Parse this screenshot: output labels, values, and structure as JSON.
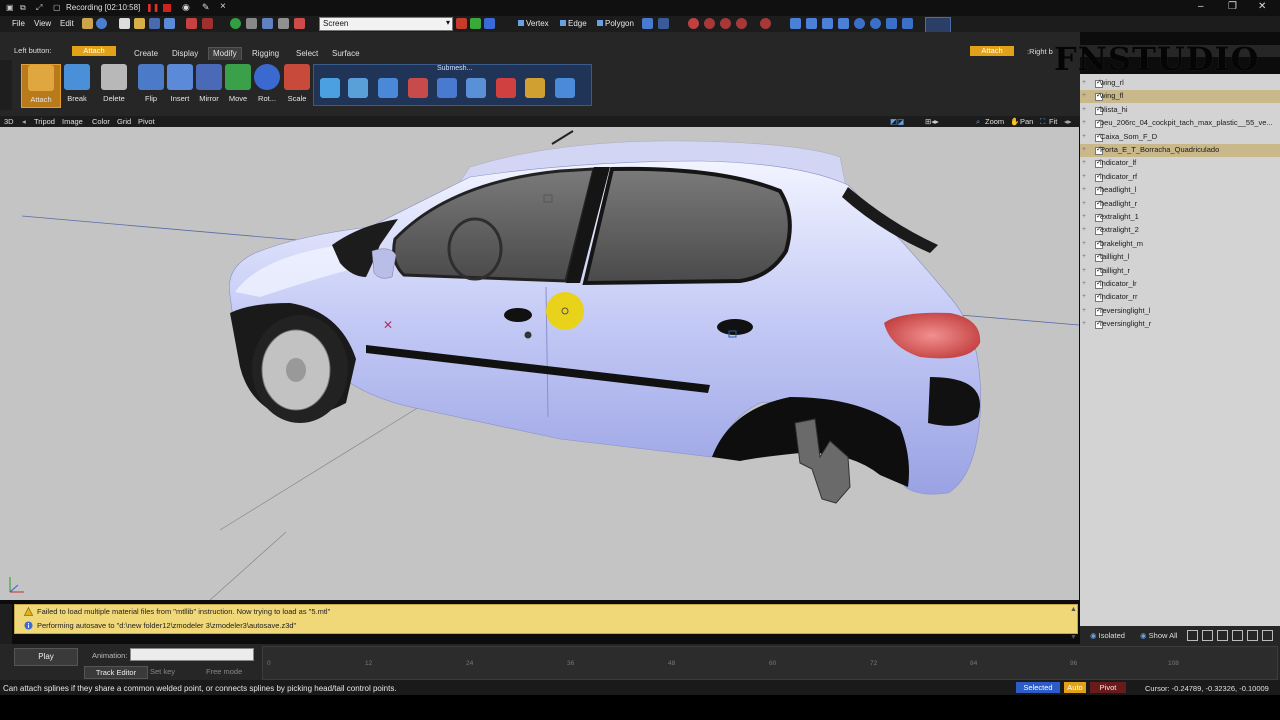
{
  "title_bar": {
    "recording": "Recording [02:10:58]"
  },
  "menu": {
    "file": "File",
    "view": "View",
    "edit": "Edit"
  },
  "toolbar": {
    "screen_select": "Screen",
    "vertex": "Vertex",
    "edge": "Edge",
    "polygon": "Polygon"
  },
  "ribbon": {
    "left_button_label": "Left button:",
    "attach_chip": "Attach",
    "tabs": [
      "Create",
      "Display",
      "Modify",
      "Rigging",
      "Select",
      "Surface"
    ],
    "tools": [
      "Attach",
      "Break",
      "Delete",
      "Flip",
      "Insert",
      "Mirror",
      "Move",
      "Rot...",
      "Scale"
    ],
    "submesh_label": "Submesh..."
  },
  "viewport_toolbar": {
    "mode": "3D",
    "items": [
      "Tripod",
      "Image",
      "Color",
      "Grid",
      "Pivot"
    ],
    "zoom": "Zoom",
    "pan": "Pan",
    "fit": "Fit"
  },
  "right_panel": {
    "attach_chip": "Attach",
    "right_button": ":Right b",
    "watermark": "FNSTUDIO",
    "tree_items": [
      {
        "label": "wing_rl",
        "checked": true,
        "selected": false
      },
      {
        "label": "wing_fl",
        "checked": true,
        "selected": true
      },
      {
        "label": "blista_hi",
        "checked": true,
        "selected": false
      },
      {
        "label": "peu_206rc_04_cockpit_tach_max_plastic__55_ve...",
        "checked": true,
        "selected": false
      },
      {
        "label": "Caixa_Som_F_D",
        "checked": true,
        "selected": false
      },
      {
        "label": "Porta_E_T_Borracha_Quadriculado",
        "checked": true,
        "selected": true
      },
      {
        "label": "indicator_lf",
        "checked": true,
        "selected": false
      },
      {
        "label": "indicator_rf",
        "checked": true,
        "selected": false
      },
      {
        "label": "headlight_l",
        "checked": true,
        "selected": false
      },
      {
        "label": "headlight_r",
        "checked": true,
        "selected": false
      },
      {
        "label": "extralight_1",
        "checked": true,
        "selected": false
      },
      {
        "label": "extralight_2",
        "checked": true,
        "selected": false
      },
      {
        "label": "brakelight_m",
        "checked": true,
        "selected": false
      },
      {
        "label": "taillight_l",
        "checked": true,
        "selected": false
      },
      {
        "label": "taillight_r",
        "checked": true,
        "selected": false
      },
      {
        "label": "indicator_lr",
        "checked": true,
        "selected": false
      },
      {
        "label": "indicator_rr",
        "checked": true,
        "selected": false
      },
      {
        "label": "reversinglight_l",
        "checked": true,
        "selected": false
      },
      {
        "label": "reversinglight_r",
        "checked": true,
        "selected": false
      }
    ],
    "isolated": "Isolated",
    "show_all": "Show All"
  },
  "messages": [
    {
      "kind": "warning",
      "text": "Failed to load multiple material files from \"mtllib\" instruction. Now trying to load as \"5.mtl\""
    },
    {
      "kind": "info",
      "text": "Performing autosave to \"d:\\new folder12\\zmodeler 3\\zmodeler3\\autosave.z3d\""
    }
  ],
  "timeline": {
    "play": "Play",
    "animation_label": "Animation:",
    "track_editor": "Track Editor",
    "set_key": "Set key",
    "free_mode": "Free mode",
    "ticks": [
      "0",
      "12",
      "24",
      "36",
      "48",
      "60",
      "72",
      "84",
      "96",
      "108"
    ]
  },
  "status": {
    "text": "Can attach splines if they share a common welded point, or connects splines by picking head/tail control points.",
    "selected": "Selected",
    "auto": "Auto",
    "pivot": "Pivot",
    "cursor": "Cursor: -0.24789, -0.32326, -0.10009"
  },
  "colors": {
    "accent_orange": "#e1a21a",
    "selected_blue": "#2d5bc8",
    "message_bg": "#f0d878",
    "viewport_bg": "#c4c4c4"
  }
}
